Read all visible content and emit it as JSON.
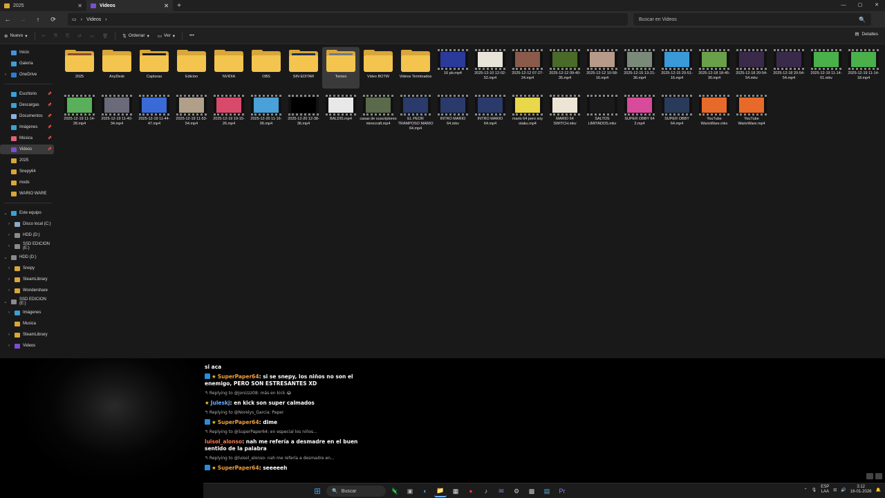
{
  "tabs": [
    {
      "label": "2025",
      "close": "✕",
      "icon": "folder-icon",
      "color": "#d9a63a"
    },
    {
      "label": "Videos",
      "close": "✕",
      "icon": "videos-folder-icon",
      "color": "#7a4fd0"
    }
  ],
  "new_tab": "+",
  "window_controls": [
    "—",
    "▢",
    "✕"
  ],
  "nav": {
    "back": "←",
    "forward": "→",
    "up": "↑",
    "refresh": "⟳"
  },
  "address": {
    "pc_icon": "▭",
    "sep1": "›",
    "folder": "Videos",
    "sep2": "›"
  },
  "search": {
    "placeholder": "Buscar en Videos",
    "icon": "🔍"
  },
  "commands": {
    "new": "Nuevo",
    "new_icon": "⊕",
    "new_arrow": "▾",
    "sort": "Ordenar",
    "sort_icon": "⇅",
    "sort_arrow": "▾",
    "view": "Ver",
    "view_icon": "▭",
    "view_arrow": "▾",
    "more": "•••",
    "details": "Detalles",
    "details_icon": "▤",
    "disabled_icons": [
      "✂",
      "⎘",
      "⎗",
      "⇄",
      "▭",
      "🗑"
    ]
  },
  "sidebar": {
    "quick": [
      {
        "label": "Inicio",
        "icon": "home-icon",
        "color": "#4a90d9",
        "pin": ""
      },
      {
        "label": "Galería",
        "icon": "gallery-icon",
        "color": "#3aa0d8",
        "pin": ""
      },
      {
        "label": "OneDrive",
        "icon": "onedrive-icon",
        "color": "#2f7bd4",
        "pin": "",
        "chevron": "›"
      }
    ],
    "pinned": [
      {
        "label": "Escritorio",
        "icon": "desktop-icon",
        "color": "#3aa0d8",
        "pin": "📌"
      },
      {
        "label": "Descargas",
        "icon": "downloads-icon",
        "color": "#3aa0d8",
        "pin": "📌"
      },
      {
        "label": "Documentos",
        "icon": "documents-icon",
        "color": "#8fb0d8",
        "pin": "📌"
      },
      {
        "label": "Imágenes",
        "icon": "pictures-icon",
        "color": "#3aa0d8",
        "pin": "📌"
      },
      {
        "label": "Música",
        "icon": "music-icon",
        "color": "#e0627a",
        "pin": "📌"
      },
      {
        "label": "Videos",
        "icon": "videos-icon",
        "color": "#7a4fd0",
        "pin": "📌",
        "selected": true
      },
      {
        "label": "2025",
        "icon": "folder-icon",
        "color": "#d9a63a",
        "pin": ""
      },
      {
        "label": "Snepy64",
        "icon": "folder-icon",
        "color": "#d9a63a",
        "pin": ""
      },
      {
        "label": "mods",
        "icon": "folder-icon",
        "color": "#d9a63a",
        "pin": ""
      },
      {
        "label": "WARIO WARE",
        "icon": "folder-icon",
        "color": "#d9a63a",
        "pin": ""
      }
    ],
    "tree": [
      {
        "label": "Este equipo",
        "icon": "pc-icon",
        "color": "#3aa0d8",
        "chevron": "⌄",
        "indent": 0
      },
      {
        "label": "Disco local (C:)",
        "icon": "drive-icon",
        "color": "#8fa8c8",
        "chevron": "›",
        "indent": 1
      },
      {
        "label": "HDD (D:)",
        "icon": "drive-icon",
        "color": "#8a8a8a",
        "chevron": "›",
        "indent": 1
      },
      {
        "label": "SSD EDICION (E:)",
        "icon": "drive-icon",
        "color": "#8a8a8a",
        "chevron": "›",
        "indent": 1
      },
      {
        "label": "HDD (D:)",
        "icon": "drive-icon",
        "color": "#8a8a8a",
        "chevron": "⌄",
        "indent": 0
      },
      {
        "label": "Snepy",
        "icon": "folder-icon",
        "color": "#d9a63a",
        "chevron": "›",
        "indent": 1
      },
      {
        "label": "SteamLibrary",
        "icon": "folder-icon",
        "color": "#d9a63a",
        "chevron": "›",
        "indent": 1
      },
      {
        "label": "Wondershare",
        "icon": "folder-icon",
        "color": "#d9a63a",
        "chevron": "›",
        "indent": 1
      },
      {
        "label": "SSD EDICION (E:)",
        "icon": "drive-icon",
        "color": "#8a8a8a",
        "chevron": "⌄",
        "indent": 0
      },
      {
        "label": "Imágenes",
        "icon": "pictures-icon",
        "color": "#3aa0d8",
        "chevron": "›",
        "indent": 1
      },
      {
        "label": "Musica",
        "icon": "folder-icon",
        "color": "#d9a63a",
        "chevron": "",
        "indent": 1
      },
      {
        "label": "SteamLibrary",
        "icon": "folder-icon",
        "color": "#d9a63a",
        "chevron": "›",
        "indent": 1
      },
      {
        "label": "Videos",
        "icon": "videos-icon",
        "color": "#7a4fd0",
        "chevron": "›",
        "indent": 1
      }
    ]
  },
  "items_row1": [
    {
      "label": "2025",
      "type": "folder",
      "preview": "#8a4a2a"
    },
    {
      "label": "AnyDesk",
      "type": "folder",
      "preview": ""
    },
    {
      "label": "Capturas",
      "type": "folder",
      "preview": "#1a1a1a"
    },
    {
      "label": "Edicion",
      "type": "folder",
      "preview": ""
    },
    {
      "label": "NVIDIA",
      "type": "folder",
      "preview": ""
    },
    {
      "label": "OBS",
      "type": "folder",
      "preview": ""
    },
    {
      "label": "SIN EDITAR",
      "type": "folder",
      "preview": "#203050"
    },
    {
      "label": "Torneo",
      "type": "folder",
      "preview": "#6a7a8a",
      "selected": true
    },
    {
      "label": "Video BOTW",
      "type": "folder",
      "preview": ""
    },
    {
      "label": "Videos Terminados",
      "type": "folder",
      "preview": ""
    },
    {
      "label": "16 pb.mp4",
      "type": "video",
      "thumb": "#2a3a9a"
    },
    {
      "label": "2025-12-10 12-02-52.mp4",
      "type": "video",
      "thumb": "#e8e4d8"
    },
    {
      "label": "2025-12-12 07-27-24.mp4",
      "type": "video",
      "thumb": "#8a5a4a"
    },
    {
      "label": "2025-12-12 09-40-35.mp4",
      "type": "video",
      "thumb": "#4a6a2a"
    },
    {
      "label": "2025-12-12 10-58-16.mp4",
      "type": "video",
      "thumb": "#b89a8a"
    },
    {
      "label": "2025-12-15 13-21-36.mp4",
      "type": "video",
      "thumb": "#7a8a7a"
    },
    {
      "label": "2025-12-15 20-51-16.mp4",
      "type": "video",
      "thumb": "#3a9ad8"
    },
    {
      "label": "2025-12-18 18-45-30.mp4",
      "type": "video",
      "thumb": "#6aa04a"
    },
    {
      "label": "2025-12-18 20-54-54.mkv",
      "type": "video",
      "thumb": "#3a2a4a"
    },
    {
      "label": "2025-12-18 20-54-54.mp4",
      "type": "video",
      "thumb": "#3a2a4a"
    },
    {
      "label": "2025-12-19 11-14-01.mkv",
      "type": "video",
      "thumb": "#4ab04a"
    },
    {
      "label": "2025-12-19 11-14-18.mp4",
      "type": "video",
      "thumb": "#4ab04a"
    }
  ],
  "items_row2": [
    {
      "label": "2025-12-19 11-14-28.mp4",
      "type": "video",
      "thumb": "#5ab05a"
    },
    {
      "label": "2025-12-19 11-40-34.mp4",
      "type": "video",
      "thumb": "#6a6a7a"
    },
    {
      "label": "2025-12-19 11-44-47.mp4",
      "type": "video",
      "thumb": "#3a6ad8"
    },
    {
      "label": "2025-12-19 11-53-54.mp4",
      "type": "video",
      "thumb": "#b0a08a"
    },
    {
      "label": "2025-12-19 19-15-26.mp4",
      "type": "video",
      "thumb": "#d84a6a"
    },
    {
      "label": "2025-12-20 11-16-06.mp4",
      "type": "video",
      "thumb": "#4aa0d8"
    },
    {
      "label": "2025-12-20 12-38-36.mp4",
      "type": "video",
      "thumb": "#000000"
    },
    {
      "label": "BALDIS.mp4",
      "type": "video",
      "thumb": "#e8e8e8"
    },
    {
      "label": "casas de suscriptores minecraft.mp4",
      "type": "video",
      "thumb": "#5a6a4a"
    },
    {
      "label": "EL PEOR TRAMPOSO MARIO 64.mp4",
      "type": "video",
      "thumb": "#2a3a6a"
    },
    {
      "label": "INTRO MARIO 64.mkv",
      "type": "video",
      "thumb": "#2a3a6a"
    },
    {
      "label": "INTRO MARIO 64.mp4",
      "type": "video",
      "thumb": "#2a3a6a"
    },
    {
      "label": "mario 64 pero soy otaku.mp4",
      "type": "video",
      "thumb": "#e8d84a"
    },
    {
      "label": "MARIO 64 SWITCH.mkv",
      "type": "video",
      "thumb": "#ece4d4"
    },
    {
      "label": "SALTOS LIMITADOS.mkv",
      "type": "video",
      "thumb": "#1a1a1a"
    },
    {
      "label": "SUPER OBBY 64 2.mp4",
      "type": "video",
      "thumb": "#d84a9a"
    },
    {
      "label": "SUPER OBBY 64.mp4",
      "type": "video",
      "thumb": "#2a3a5a"
    },
    {
      "label": "YouTube WarioWare.mkv",
      "type": "video",
      "thumb": "#e86a2a"
    },
    {
      "label": "YouTube WarioWare.mp4",
      "type": "video",
      "thumb": "#e86a2a"
    }
  ],
  "chat": [
    {
      "kind": "text",
      "text": "si aca"
    },
    {
      "kind": "msg",
      "badges": true,
      "name": "SuperPaper64",
      "name_color": "#f0a040",
      "text": ": si se snepy, los niños no son el enemigo, PERO SON ESTRESANTES XD"
    },
    {
      "kind": "reply",
      "text": "↰ Replying to @Jonizzz08: más en kick 😂"
    },
    {
      "kind": "msg",
      "star_only": true,
      "name": "Juleskj",
      "name_color": "#6ab0ff",
      "text": ": en kick son super calmados"
    },
    {
      "kind": "reply",
      "text": "↰ Replying to @Norelys_Garcia: Paper"
    },
    {
      "kind": "msg",
      "badges": true,
      "name": "SuperPaper64",
      "name_color": "#f0a040",
      "text": ": dime"
    },
    {
      "kind": "reply",
      "text": "↰ Replying to @SuperPaper64: en especial los niños..."
    },
    {
      "kind": "msg",
      "name": "luisol_alonso",
      "name_color": "#ff7a4a",
      "text": ": nah me refería a desmadre en el buen sentido de la palabra"
    },
    {
      "kind": "reply",
      "text": "↰ Replying to @luisol_alonso: nah me refería a desmadre en..."
    },
    {
      "kind": "msg",
      "badges": true,
      "name": "SuperPaper64",
      "name_color": "#f0a040",
      "text": ": seeeeeh"
    }
  ],
  "taskbar": {
    "start_icon": "⊞",
    "search_icon": "🔍",
    "search_label": "Buscar",
    "apps": [
      "🦎",
      "▣",
      "◐",
      "📁",
      "▦",
      "●",
      "♪",
      "✉",
      "⚙",
      "▩",
      "▤",
      "Pr"
    ],
    "tray_up": "⌃",
    "lang1": "ESP",
    "lang2": "LAA",
    "mic": "🎙",
    "net": "⊟",
    "vol": "🔊",
    "time": "3:12",
    "date": "16-01-2026",
    "bell": "🔔"
  }
}
